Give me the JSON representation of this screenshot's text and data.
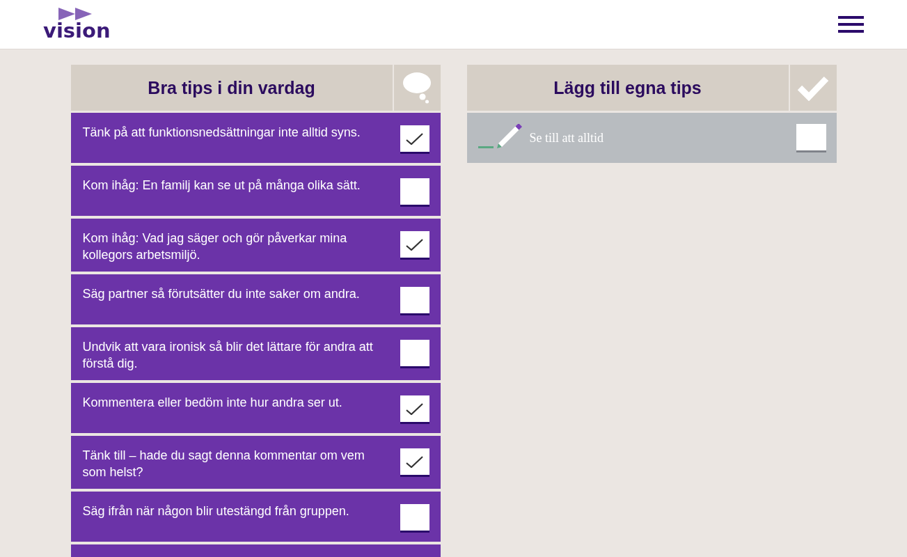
{
  "header": {
    "logo_text": "vision"
  },
  "tips_panel": {
    "title": "Bra tips i din vardag",
    "tips": [
      {
        "text": "Tänk på att funktionsnedsättningar inte alltid syns.",
        "checked": true
      },
      {
        "text": "Kom ihåg: En familj kan se ut på många olika sätt.",
        "checked": false
      },
      {
        "text": "Kom ihåg: Vad jag säger och gör påverkar mina kollegors arbetsmiljö.",
        "checked": true
      },
      {
        "text": "Säg partner så förutsätter du inte saker om andra.",
        "checked": false
      },
      {
        "text": "Undvik att vara ironisk så blir det lättare för andra att förstå dig.",
        "checked": false
      },
      {
        "text": "Kommentera eller bedöm inte hur andra ser ut.",
        "checked": true
      },
      {
        "text": "Tänk till – hade du sagt denna kommentar om vem som helst?",
        "checked": true
      },
      {
        "text": "Säg ifrån när någon blir utestängd från gruppen.",
        "checked": false
      }
    ],
    "partial_row_below": true
  },
  "own_tips_panel": {
    "title": "Lägg till egna tips",
    "new_tip": {
      "placeholder": "Se till att alltid",
      "checked": false
    }
  }
}
